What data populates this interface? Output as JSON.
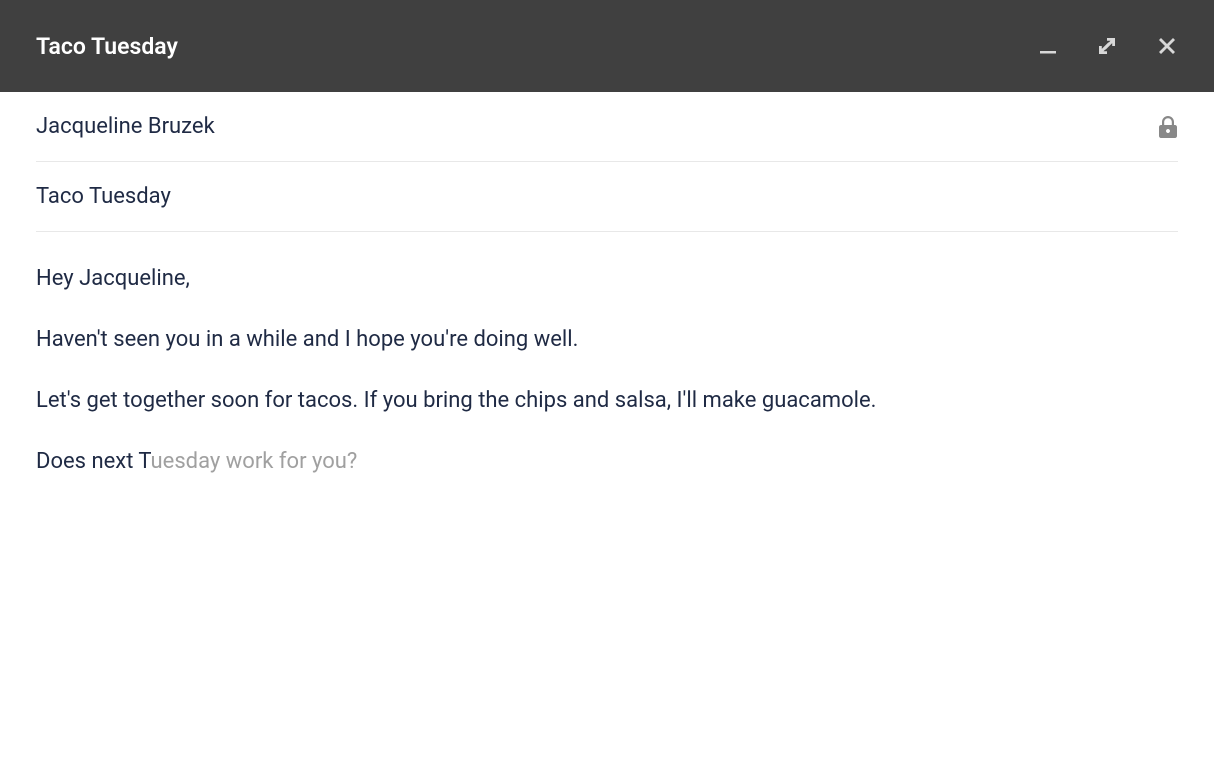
{
  "header": {
    "title": "Taco Tuesday"
  },
  "recipient": {
    "name": "Jacqueline Bruzek"
  },
  "subject": {
    "text": "Taco Tuesday"
  },
  "body": {
    "line1": "Hey Jacqueline,",
    "line2": "Haven't seen you in a while and I hope you're doing well.",
    "line3": "Let's get together soon for tacos. If you bring the chips and salsa, I'll make guacamole.",
    "typed": "Does next T",
    "suggested": "uesday work for you?"
  }
}
